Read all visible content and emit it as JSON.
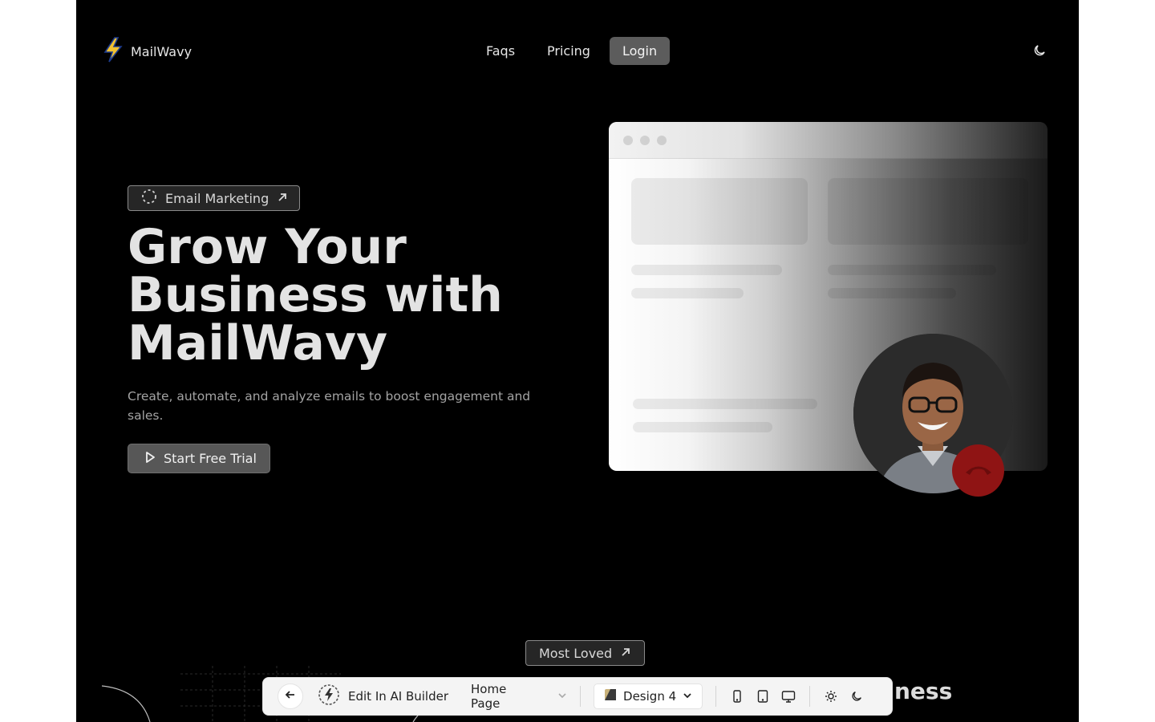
{
  "header": {
    "logo_text": "MailWavy",
    "logo_icon": "lightning-bolt-icon",
    "nav": [
      {
        "label": "Faqs"
      },
      {
        "label": "Pricing"
      },
      {
        "label": "Login"
      }
    ],
    "theme_toggle_icon": "moon-icon"
  },
  "hero": {
    "badge_label": "Email Marketing",
    "title_line1": "Grow Your",
    "title_line2": "Business with",
    "title_line3": "MailWavy",
    "subtitle": "Create, automate, and analyze emails to boost engagement and sales.",
    "cta_label": "Start Free Trial"
  },
  "bottom": {
    "badge_label": "Most Loved",
    "heading_fragment": "ness"
  },
  "toolbar": {
    "edit_label": "Edit In AI Builder",
    "page_select_value": "Home Page",
    "design_label": "Design 4"
  },
  "colors": {
    "background": "#000000",
    "nav_active": "#5c5c5c",
    "hangup": "#8f1414",
    "toolbar_bg": "#f4f4f4"
  }
}
